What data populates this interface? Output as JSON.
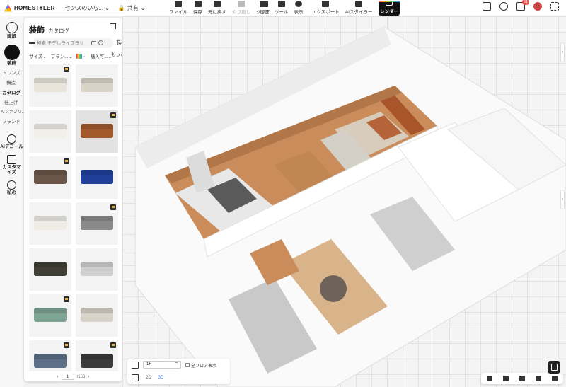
{
  "topbar": {
    "logo": "HOMESTYLER",
    "project_name": "センスのいら...",
    "share_label": "共有",
    "tools": [
      {
        "label": "ファイル",
        "icon": "folder-icon"
      },
      {
        "label": "保存",
        "icon": "save-icon"
      },
      {
        "label": "元に戻す",
        "icon": "undo-icon"
      },
      {
        "label": "やり直し",
        "icon": "redo-icon",
        "disabled": true
      },
      {
        "label": "クリア",
        "icon": "eraser-icon"
      }
    ],
    "tools2": [
      {
        "label": "建設",
        "icon": "build-icon"
      },
      {
        "label": "ツール",
        "icon": "tool-icon"
      },
      {
        "label": "表示",
        "icon": "eye-icon"
      }
    ],
    "tools3": [
      {
        "label": "エクスポート",
        "icon": "export-icon"
      },
      {
        "label": "AIスタイラー",
        "icon": "ai-styler-icon"
      },
      {
        "label": "画像",
        "icon": "image-icon"
      }
    ],
    "render_label": "レンダー",
    "notifications_count": "51"
  },
  "leftnav": {
    "items": [
      {
        "label": "建設",
        "icon": "build-icon"
      },
      {
        "label": "装飾",
        "icon": "decor-icon",
        "active": true
      }
    ],
    "sub_items": [
      {
        "label": "トレンズ"
      },
      {
        "label": "構造"
      },
      {
        "label": "カタログ",
        "active": true
      },
      {
        "label": "仕上げ"
      },
      {
        "label": "AIファブリ..."
      },
      {
        "label": "ブランド"
      }
    ],
    "bottom_items": [
      {
        "label": "AIデコール",
        "icon": "ai-decor-icon"
      },
      {
        "label": "カスタマイズ",
        "icon": "customize-icon"
      },
      {
        "label": "私の",
        "icon": "my-icon"
      }
    ]
  },
  "panel": {
    "title": "装飾",
    "tab": "カタログ",
    "search_placeholder": "検索 モデルライブラリ",
    "filters": [
      "サイズ",
      "ブラン...",
      "購入可...",
      "もっと"
    ],
    "pager": {
      "current": "1",
      "total": "/166"
    },
    "items": [
      {
        "color": "#e8e4da",
        "vip": true
      },
      {
        "color": "#d9d3c7",
        "vip": false
      },
      {
        "color": "#f1efe9",
        "vip": false
      },
      {
        "color": "#a25a2c",
        "vip": true
      },
      {
        "color": "#6b5548",
        "vip": true
      },
      {
        "color": "#1f3f9a",
        "vip": false
      },
      {
        "color": "#efece6",
        "vip": false
      },
      {
        "color": "#8a8a8a",
        "vip": true
      },
      {
        "color": "#3f3f36",
        "vip": false
      },
      {
        "color": "#cfcfcf",
        "vip": false
      },
      {
        "color": "#7ea495",
        "vip": true
      },
      {
        "color": "#d8d2c8",
        "vip": false
      },
      {
        "color": "#5d6f86",
        "vip": true
      },
      {
        "color": "#3a3a3a",
        "vip": true
      }
    ]
  },
  "bottombar": {
    "floor": "1F",
    "all_floors_label": "全フロア表示",
    "view_2d": "2D",
    "view_3d": "3D"
  }
}
